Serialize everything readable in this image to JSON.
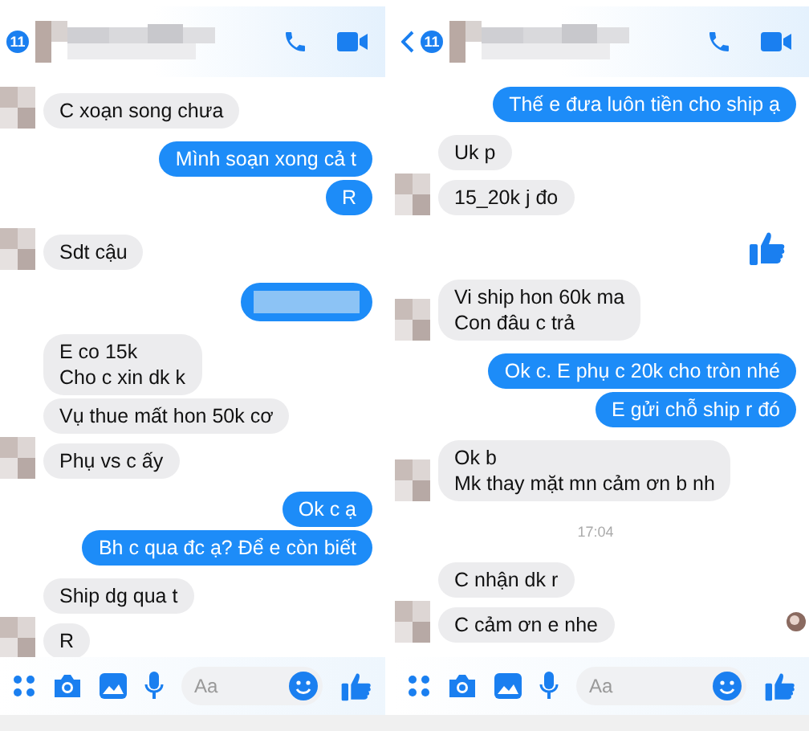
{
  "panels": [
    {
      "header": {
        "badge": "11"
      },
      "composer": {
        "placeholder": "Aa"
      },
      "messages": [
        {
          "kind": "text",
          "outgoing": false,
          "avatar": true,
          "lines": [
            "C xoạn song chưa"
          ]
        },
        {
          "kind": "text",
          "outgoing": true,
          "lines": [
            "Mình soạn xong cả t"
          ]
        },
        {
          "kind": "text",
          "outgoing": true,
          "lines": [
            "R"
          ]
        },
        {
          "kind": "text",
          "outgoing": false,
          "avatar": true,
          "lines": [
            "Sdt cậu"
          ]
        },
        {
          "kind": "redacted",
          "outgoing": true
        },
        {
          "kind": "text",
          "outgoing": false,
          "avatar": false,
          "lines": [
            "E co 15k",
            "Cho c xin dk k"
          ]
        },
        {
          "kind": "text",
          "outgoing": false,
          "avatar": false,
          "lines": [
            "Vụ thue mất hon 50k cơ"
          ]
        },
        {
          "kind": "text",
          "outgoing": false,
          "avatar": true,
          "lines": [
            "Phụ vs c ấy"
          ]
        },
        {
          "kind": "text",
          "outgoing": true,
          "lines": [
            "Ok c ạ"
          ]
        },
        {
          "kind": "text",
          "outgoing": true,
          "lines": [
            "Bh c qua đc ạ? Để e còn biết"
          ]
        },
        {
          "kind": "text",
          "outgoing": false,
          "avatar": false,
          "lines": [
            "Ship dg qua t"
          ]
        },
        {
          "kind": "text",
          "outgoing": false,
          "avatar": true,
          "lines": [
            "R"
          ]
        }
      ]
    },
    {
      "header": {
        "back": true,
        "badge": "11"
      },
      "composer": {
        "placeholder": "Aa"
      },
      "seen": true,
      "messages": [
        {
          "kind": "text",
          "outgoing": true,
          "lines": [
            "Thế e đưa luôn tiền cho ship ạ"
          ]
        },
        {
          "kind": "text",
          "outgoing": false,
          "avatar": false,
          "lines": [
            "Uk p"
          ]
        },
        {
          "kind": "text",
          "outgoing": false,
          "avatar": true,
          "lines": [
            "15_20k j đo"
          ]
        },
        {
          "kind": "like",
          "outgoing": true
        },
        {
          "kind": "text",
          "outgoing": false,
          "avatar": true,
          "lines": [
            "Vi ship hon 60k ma",
            "Con đâu c trả"
          ]
        },
        {
          "kind": "text",
          "outgoing": true,
          "lines": [
            "Ok c. E phụ c 20k cho tròn nhé"
          ]
        },
        {
          "kind": "text",
          "outgoing": true,
          "lines": [
            "E gửi chỗ ship r đó"
          ]
        },
        {
          "kind": "text",
          "outgoing": false,
          "avatar": true,
          "lines": [
            "Ok b",
            "Mk thay mặt mn cảm ơn b nh"
          ]
        },
        {
          "kind": "time",
          "text": "17:04"
        },
        {
          "kind": "text",
          "outgoing": false,
          "avatar": false,
          "lines": [
            "C nhận dk r"
          ]
        },
        {
          "kind": "text",
          "outgoing": false,
          "avatar": true,
          "lines": [
            "C cảm ơn e nhe"
          ]
        }
      ]
    }
  ]
}
